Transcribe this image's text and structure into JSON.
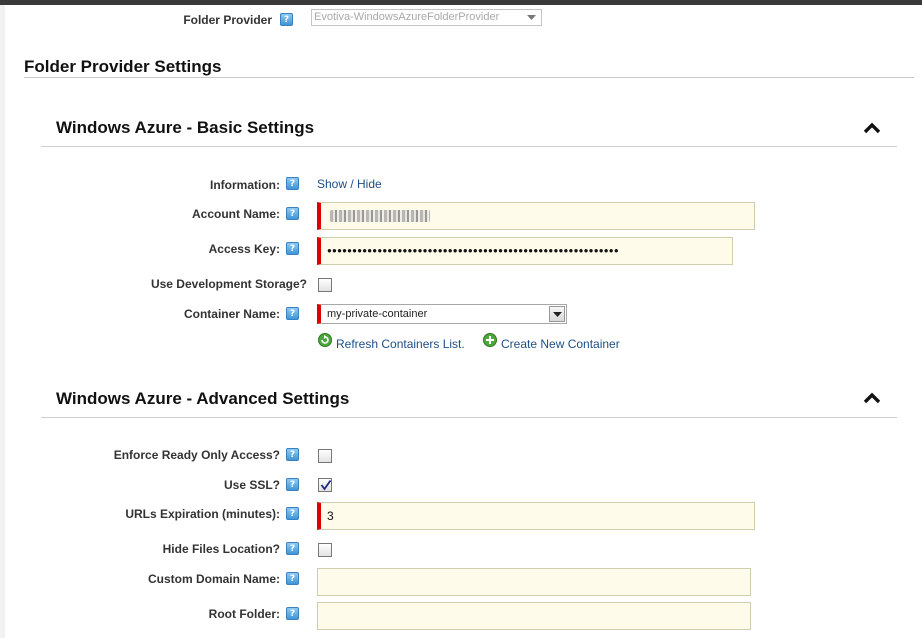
{
  "folder_provider": {
    "label": "Folder Provider",
    "selected": "Evotiva-WindowsAzureFolderProvider"
  },
  "settings_title": "Folder Provider Settings",
  "basic": {
    "title": "Windows Azure - Basic Settings",
    "information": {
      "label": "Information:",
      "link": "Show / Hide"
    },
    "account_name": {
      "label": "Account Name:",
      "value": ""
    },
    "access_key": {
      "label": "Access Key:",
      "value": "●●●●●●●●●●●●●●●●●●●●●●●●●●●●●●●●●●●●●●●●●●●●●●●●●●●●●●●●●●"
    },
    "use_dev_storage": {
      "label": "Use Development Storage?",
      "checked": false
    },
    "container_name": {
      "label": "Container Name:",
      "selected": "my-private-container"
    },
    "refresh_link": "Refresh Containers List.",
    "create_link": "Create New Container"
  },
  "advanced": {
    "title": "Windows Azure - Advanced Settings",
    "enforce_read_only": {
      "label": "Enforce Ready Only Access?",
      "checked": false
    },
    "use_ssl": {
      "label": "Use SSL?",
      "checked": true
    },
    "urls_expiration": {
      "label": "URLs Expiration (minutes):",
      "value": "3"
    },
    "hide_files_location": {
      "label": "Hide Files Location?",
      "checked": false
    },
    "custom_domain": {
      "label": "Custom Domain Name:",
      "value": ""
    },
    "root_folder": {
      "label": "Root Folder:",
      "value": ""
    }
  },
  "help_glyph": "?",
  "icons": {
    "help": "help-icon",
    "collapse": "chevron-up-icon",
    "refresh": "refresh-icon",
    "add": "add-icon",
    "dropdown": "chevron-down-icon"
  },
  "colors": {
    "required_marker": "#e00000",
    "input_bg": "#fffbea",
    "link": "#1d4f86",
    "help_icon": "#3f95d6"
  }
}
